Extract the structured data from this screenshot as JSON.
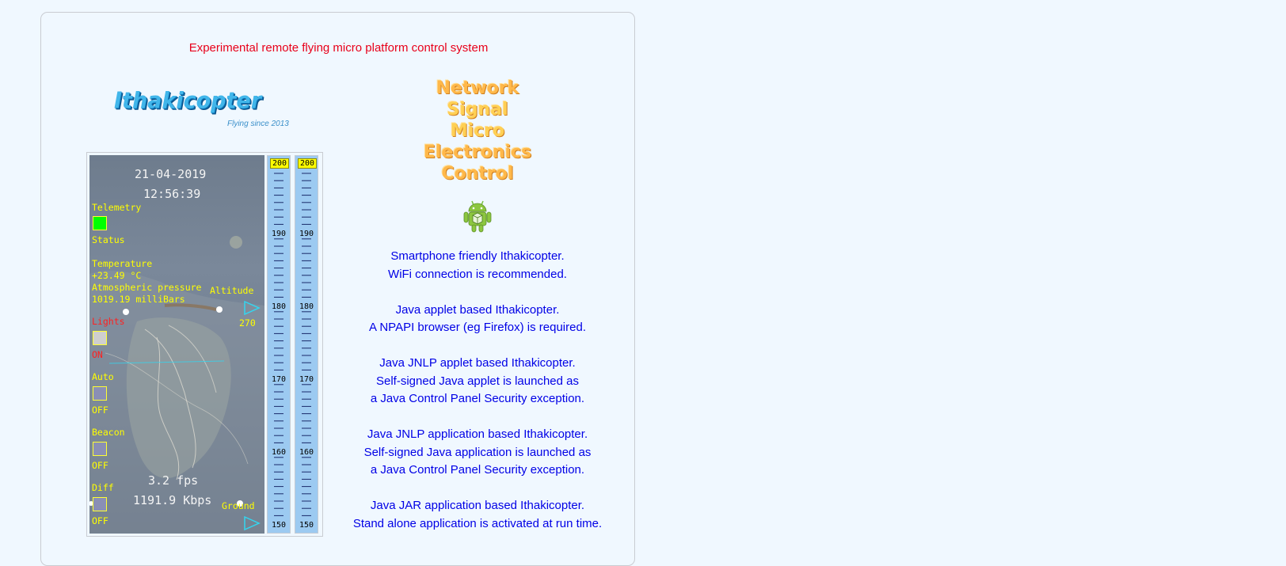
{
  "header": {
    "title": "Experimental remote flying micro platform control system"
  },
  "logo": {
    "name": "Ithakicopter",
    "tagline": "Flying since 2013"
  },
  "network_logo": {
    "lines": [
      "Network",
      "Signal",
      "Micro",
      "Electronics",
      "Control"
    ]
  },
  "android_icon": "android-icon",
  "info_blocks": [
    {
      "lines": [
        "Smartphone friendly Ithakicopter.",
        "WiFi connection is recommended."
      ]
    },
    {
      "lines": [
        "Java applet based Ithakicopter.",
        "A NPAPI browser (eg Firefox) is required."
      ]
    },
    {
      "lines": [
        "Java JNLP applet based Ithakicopter.",
        "Self-signed Java applet is launched as",
        "a Java Control Panel Security exception."
      ]
    },
    {
      "lines": [
        "Java JNLP application based Ithakicopter.",
        "Self-signed Java application is launched as",
        "a Java Control Panel Security exception."
      ]
    },
    {
      "lines": [
        "Java JAR application based Ithakicopter.",
        "Stand alone application is activated at run time."
      ]
    }
  ],
  "camera": {
    "date": "21-04-2019",
    "time": "12:56:39",
    "telemetry_label": "Telemetry",
    "status_label": "Status",
    "temperature_label": "Temperature",
    "temperature_value": "+23.49 °C",
    "pressure_label": "Atmospheric pressure",
    "pressure_value": "1019.19 milliBars",
    "altitude_label": "Altitude",
    "altitude_value": "270",
    "lights_label": "Lights",
    "lights_state": "ON",
    "auto_label": "Auto",
    "auto_state": "OFF",
    "beacon_label": "Beacon",
    "beacon_state": "OFF",
    "fps": "3.2 fps",
    "bitrate": "1191.9 Kbps",
    "diff_label": "Diff",
    "diff_state": "OFF",
    "ground_label": "Ground",
    "colors": {
      "telemetry_on": "#00ff00",
      "overlay_text": "#ffff00",
      "lights_text": "#ff2020",
      "arrow": "#33d6f0"
    }
  },
  "gauges": [
    {
      "top": "200",
      "labels": [
        "190",
        "180",
        "170",
        "160",
        "150"
      ]
    },
    {
      "top": "200",
      "labels": [
        "190",
        "180",
        "170",
        "160",
        "150"
      ]
    }
  ]
}
